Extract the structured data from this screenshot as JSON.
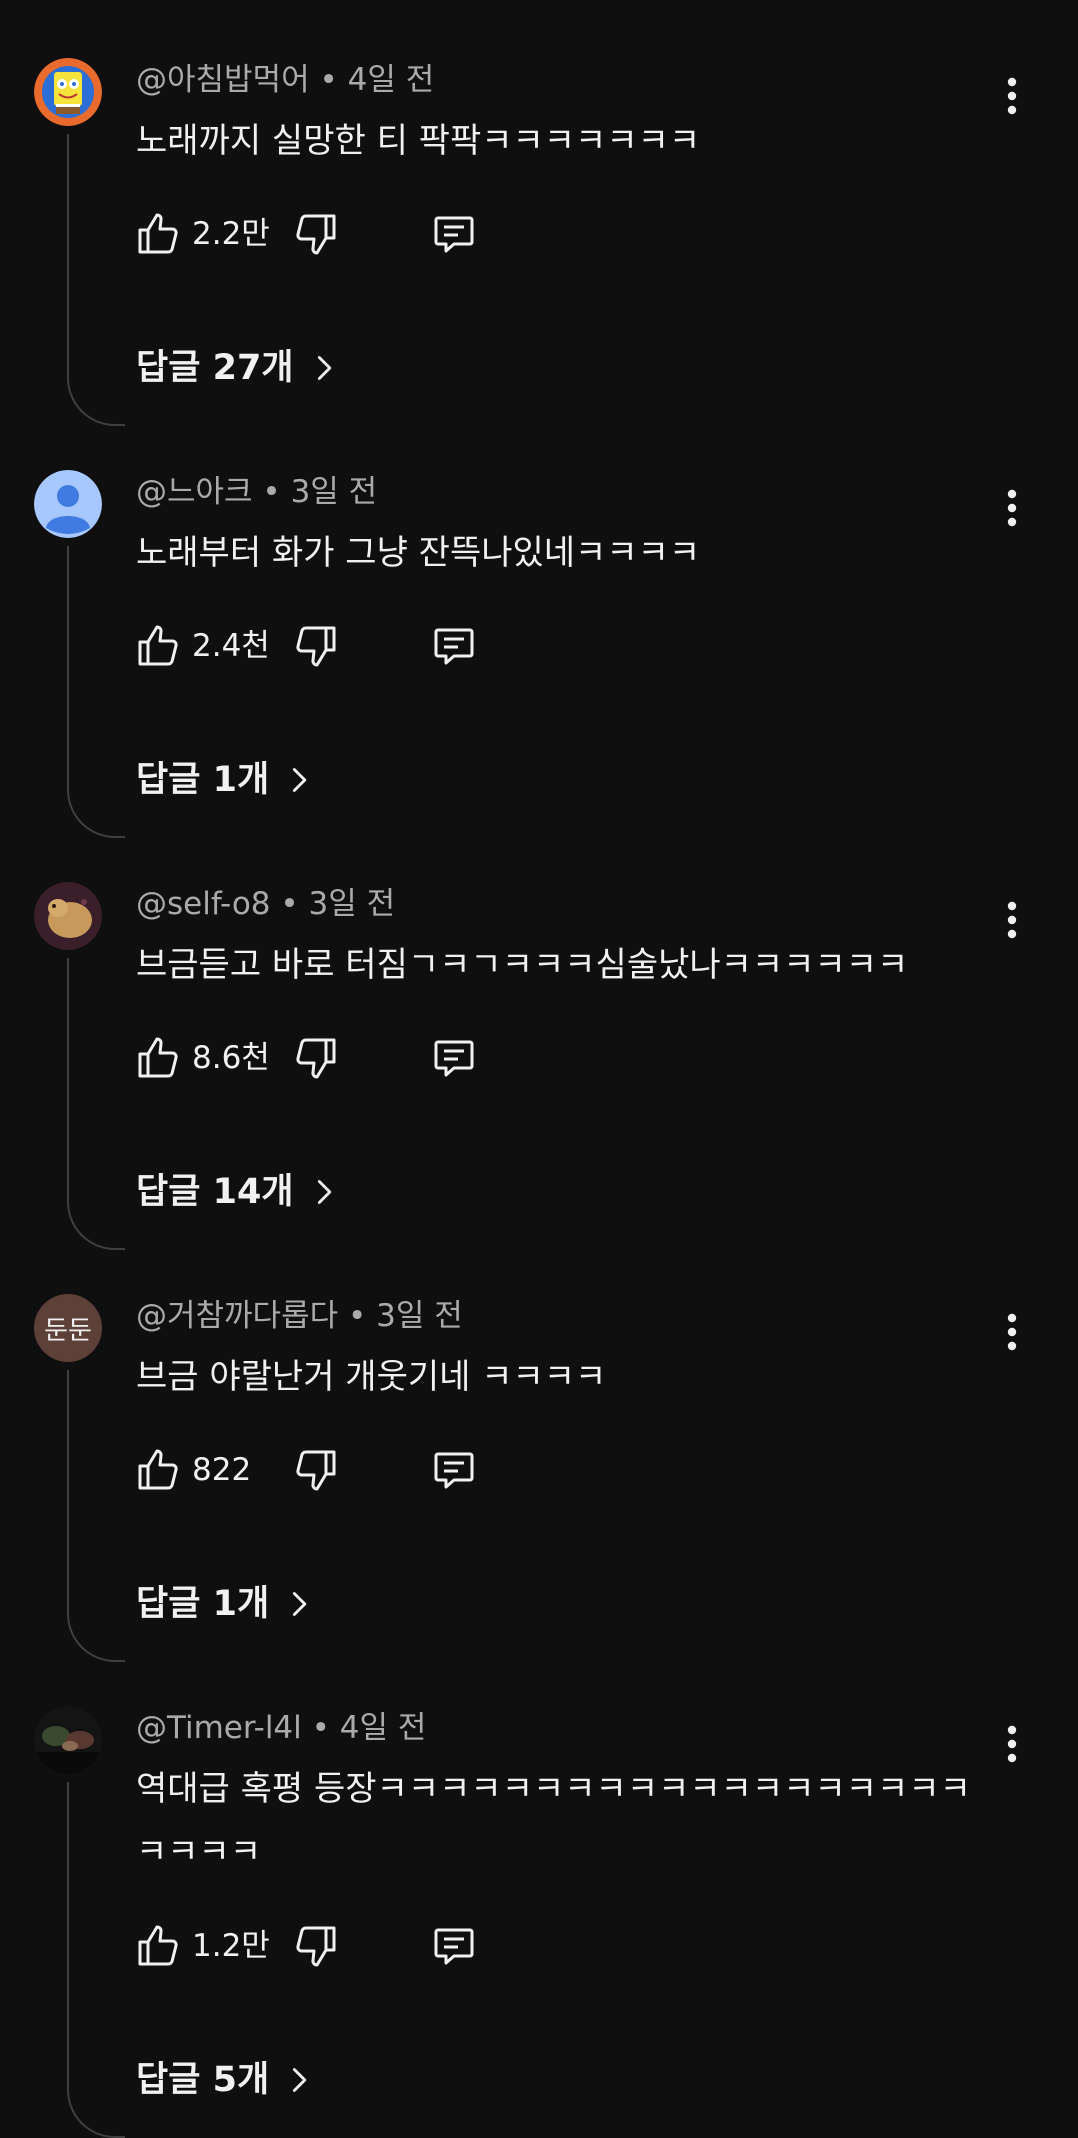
{
  "comments": [
    {
      "author": "@아침밥먹어",
      "time": "4일 전",
      "text": "노래까지 실망한 티 팍팍ㅋㅋㅋㅋㅋㅋㅋ",
      "likes": "2.2만",
      "replies": "답글 27개",
      "avatar": "spongebob-avatar"
    },
    {
      "author": "@느아크",
      "time": "3일 전",
      "text": "노래부터 화가 그냥 잔뜩나있네ㅋㅋㅋㅋ",
      "likes": "2.4천",
      "replies": "답글 1개",
      "avatar": "default-person-avatar"
    },
    {
      "author": "@self-o8",
      "time": "3일 전",
      "text": "브금듣고 바로 터짐ㄱㅋㄱㅋㅋㅋ심술났나ㅋㅋㅋㅋㅋㅋ",
      "likes": "8.6천",
      "replies": "답글 14개",
      "avatar": "potato-avatar"
    },
    {
      "author": "@거참까다롭다",
      "time": "3일 전",
      "text": "브금 야랄난거 개웃기네 ㅋㅋㅋㅋ",
      "likes": "822",
      "replies": "답글 1개",
      "avatar": "text-avatar",
      "avatar_text": "둔둔"
    },
    {
      "author": "@Timer-l4l",
      "time": "4일 전",
      "text": "역대급 혹평 등장ㅋㅋㅋㅋㅋㅋㅋㅋㅋㅋㅋㅋㅋㅋㅋㅋㅋㅋㅋㅋㅋㅋㅋ",
      "likes": "1.2만",
      "replies": "답글 5개",
      "avatar": "dark-photo-avatar"
    }
  ],
  "meta_separator": " • ",
  "colors": {
    "background": "#0f0f0f",
    "primary_text": "#f1f1f1",
    "secondary_text": "#aaaaaa",
    "thread_line": "#3f3f3f",
    "text_avatar_bg": "#5d4037"
  },
  "icons": [
    "more-vert-icon",
    "thumb-up-icon",
    "thumb-down-icon",
    "reply-comment-icon",
    "chevron-right-icon"
  ]
}
